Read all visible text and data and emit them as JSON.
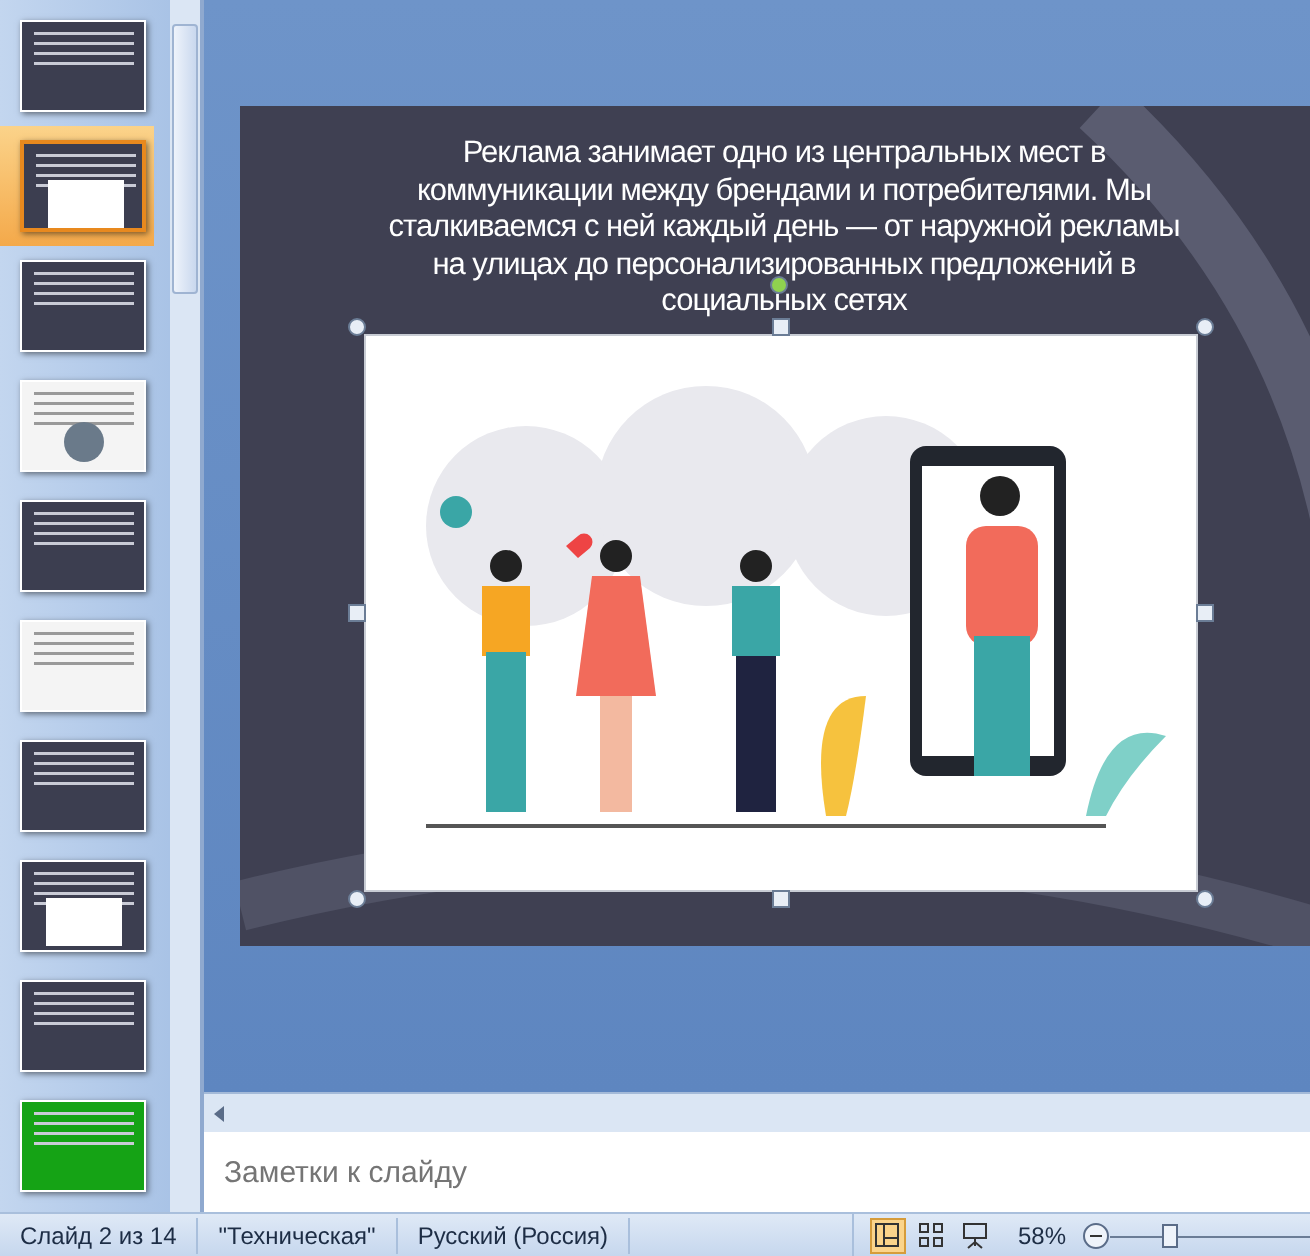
{
  "thumbnails": [
    {
      "kind": "dark",
      "selected": false
    },
    {
      "kind": "dark-picture",
      "selected": true
    },
    {
      "kind": "dark",
      "selected": false
    },
    {
      "kind": "light-picture",
      "selected": false
    },
    {
      "kind": "dark",
      "selected": false
    },
    {
      "kind": "light",
      "selected": false
    },
    {
      "kind": "dark",
      "selected": false
    },
    {
      "kind": "dark-picture",
      "selected": false
    },
    {
      "kind": "dark",
      "selected": false
    },
    {
      "kind": "green",
      "selected": false
    }
  ],
  "slide": {
    "text": "Реклама занимает одно из центральных мест в коммуникации между брендами и потребителями. Мы сталкиваемся с ней каждый день — от наружной рекламы на улицах до персонализированных предложений в социальных сетях",
    "picture_selected": true
  },
  "notes": {
    "placeholder": "Заметки к слайду"
  },
  "status_bar": {
    "slide": "Слайд 2 из 14",
    "theme": "\"Техническая\"",
    "language": "Русский (Россия)",
    "views": [
      {
        "kind": "normal",
        "selected": true
      },
      {
        "kind": "sorter",
        "selected": false
      },
      {
        "kind": "show",
        "selected": false
      }
    ],
    "zoom": "58%",
    "zoom_slider": {
      "level": 0.3
    }
  }
}
